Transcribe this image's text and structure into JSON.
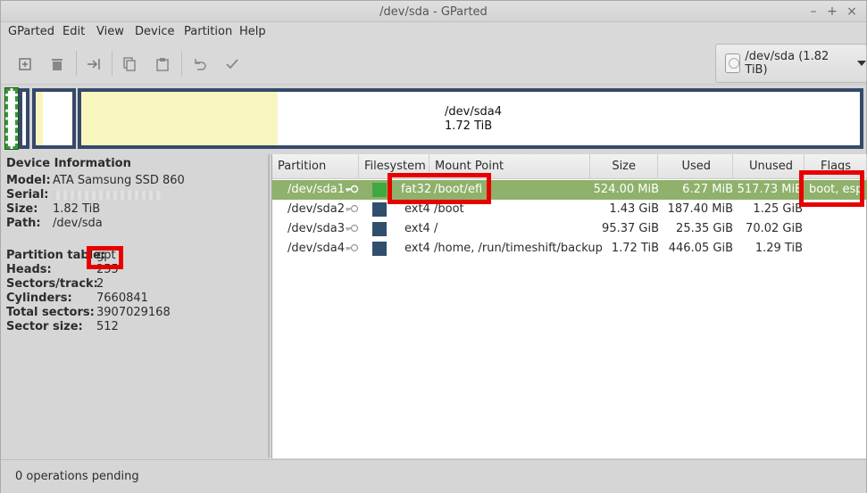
{
  "window": {
    "title": "/dev/sda - GParted",
    "controls": [
      "–",
      "+",
      "×"
    ]
  },
  "menu": [
    "GParted",
    "Edit",
    "View",
    "Device",
    "Partition",
    "Help"
  ],
  "toolbar": {
    "icons": [
      "new-partition-icon",
      "delete-icon",
      "resize-move-icon",
      "copy-icon",
      "paste-icon",
      "undo-icon",
      "apply-icon"
    ]
  },
  "device_selector": {
    "label": "/dev/sda (1.82 TiB)"
  },
  "disk_map": {
    "selected_label_line1": "/dev/sda4",
    "selected_label_line2": "1.72 TiB"
  },
  "device_info": {
    "header": "Device Information",
    "fields": [
      {
        "key": "Model:",
        "value": "ATA Samsung SSD 860"
      },
      {
        "key": "Serial:",
        "value": ""
      },
      {
        "key": "Size:",
        "value": "1.82 TiB"
      },
      {
        "key": "Path:",
        "value": "/dev/sda"
      },
      {
        "key": "Partition table:",
        "value": "gpt"
      },
      {
        "key": "Heads:",
        "value": "255"
      },
      {
        "key": "Sectors/track:",
        "value": "2"
      },
      {
        "key": "Cylinders:",
        "value": "7660841"
      },
      {
        "key": "Total sectors:",
        "value": "3907029168"
      },
      {
        "key": "Sector size:",
        "value": "512"
      }
    ]
  },
  "table": {
    "columns": [
      "Partition",
      "Filesystem",
      "Mount Point",
      "Size",
      "Used",
      "Unused",
      "Flags"
    ],
    "rows": [
      {
        "partition": "/dev/sda1",
        "fs": "fat32",
        "mount": "/boot/efi",
        "size": "524.00 MiB",
        "used": "6.27 MiB",
        "unused": "517.73 MiB",
        "flags": "boot, esp",
        "fs_color": "#3fa83f"
      },
      {
        "partition": "/dev/sda2",
        "fs": "ext4",
        "mount": "/boot",
        "size": "1.43 GiB",
        "used": "187.40 MiB",
        "unused": "1.25 GiB",
        "flags": "",
        "fs_color": "#314e6c"
      },
      {
        "partition": "/dev/sda3",
        "fs": "ext4",
        "mount": "/",
        "size": "95.37 GiB",
        "used": "25.35 GiB",
        "unused": "70.02 GiB",
        "flags": "",
        "fs_color": "#314e6c"
      },
      {
        "partition": "/dev/sda4",
        "fs": "ext4",
        "mount": "/home, /run/timeshift/backup",
        "size": "1.72 TiB",
        "used": "446.05 GiB",
        "unused": "1.29 TiB",
        "flags": "",
        "fs_color": "#314e6c"
      }
    ]
  },
  "status": {
    "text": "0 operations pending"
  },
  "colors": {
    "selected_row": "#8fb16b",
    "partition_border": "#35496a",
    "used_space": "#f8f6bf",
    "highlight": "#e80000"
  }
}
